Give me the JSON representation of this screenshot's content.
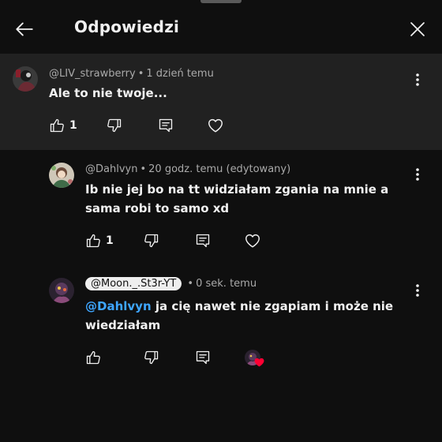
{
  "header": {
    "title": "Odpowiedzi"
  },
  "comments": [
    {
      "author": "@LIV_strawberry",
      "time": "1 dzień temu",
      "text": "Ale to nie twoje...",
      "likes": "1"
    },
    {
      "author": "@Dahlvyn",
      "time": "20 godz. temu (edytowany)",
      "text": "Ib nie jej bo na tt widziałam zgania na mnie a sama robi to samo xd",
      "likes": "1"
    },
    {
      "author": "@Moon._.St3r-YT",
      "time": "0 sek. temu",
      "mention": "@Dahlvyn",
      "text": " ja cię nawet nie zgapiam i może nie wiedziałam"
    }
  ],
  "icons": {
    "back": "arrow-left-icon",
    "close": "close-icon",
    "more": "more-vertical-icon",
    "like": "thumbs-up-icon",
    "dislike": "thumbs-down-icon",
    "reply": "comment-icon",
    "heart": "heart-icon"
  },
  "colors": {
    "background": "#0f0f0f",
    "highlight": "#212121",
    "mention": "#3ea6ff",
    "heart": "#ff0033",
    "secondary_text": "#aaaaaa"
  }
}
